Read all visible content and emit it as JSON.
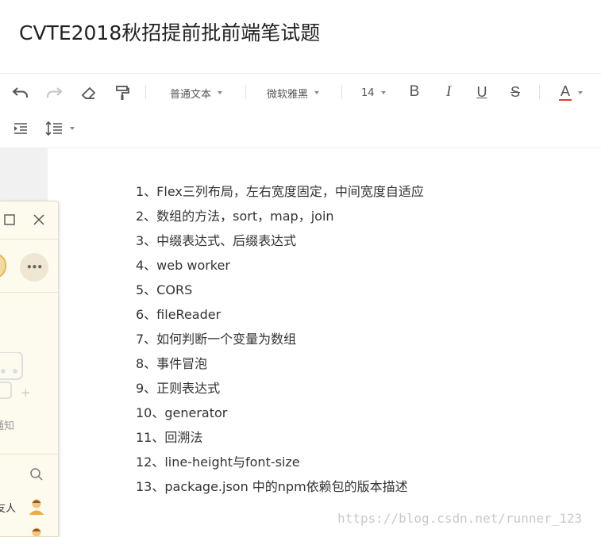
{
  "document": {
    "title": "CVTE2018秋招提前批前端笔试题"
  },
  "toolbar": {
    "paragraph_style": "普通文本",
    "font_family": "微软雅黑",
    "font_size": "14",
    "bold": "B",
    "italic": "I",
    "underline": "U",
    "strike": "S",
    "font_color": "A",
    "font_color_value": "#e03e2d"
  },
  "content": {
    "lines": [
      "1、Flex三列布局，左右宽度固定，中间宽度自适应",
      "2、数组的方法，sort，map，join",
      "3、中缀表达式、后缀表达式",
      "4、web worker",
      "5、CORS",
      "6、fileReader",
      "7、如何判断一个变量为数组",
      "8、事件冒泡",
      "9、正则表达式",
      "10、generator",
      "11、回溯法",
      "12、line-height与font-size",
      "13、package.json 中的npm依赖包的版本描述"
    ]
  },
  "side_panel": {
    "notice_label": "通知",
    "contact_label": "友人",
    "more_label": "•••",
    "plus_label": "+"
  },
  "watermark": "https://blog.csdn.net/runner_123"
}
